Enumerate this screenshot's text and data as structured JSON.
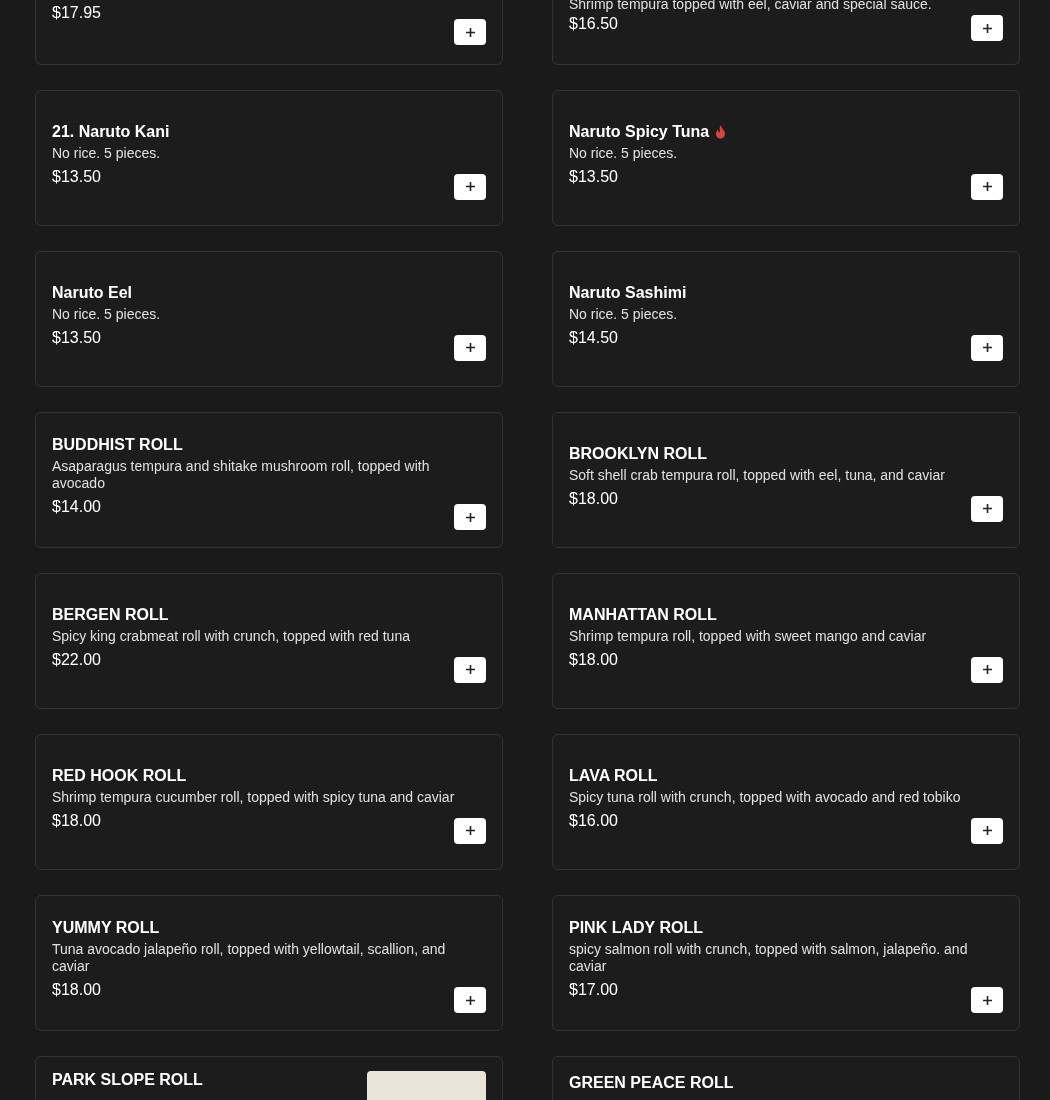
{
  "items": [
    {
      "kind": "top",
      "price": "$17.95"
    },
    {
      "kind": "top",
      "description": "Shrimp tempura topped with eel, caviar and special sauce.",
      "price": "$16.50"
    },
    {
      "kind": "full",
      "name": "21. Naruto Kani",
      "description": "No rice. 5 pieces.",
      "price": "$13.50",
      "spicy": false
    },
    {
      "kind": "full",
      "name": "Naruto Spicy Tuna",
      "description": "No rice. 5 pieces.",
      "price": "$13.50",
      "spicy": true
    },
    {
      "kind": "full",
      "name": "Naruto Eel",
      "description": "No rice. 5 pieces.",
      "price": "$13.50",
      "spicy": false
    },
    {
      "kind": "full",
      "name": "Naruto Sashimi",
      "description": "No rice. 5 pieces.",
      "price": "$14.50",
      "spicy": false
    },
    {
      "kind": "full",
      "name": "BUDDHIST ROLL",
      "description": "Asaparagus tempura and shitake mushroom roll, topped with avocado",
      "price": "$14.00",
      "spicy": false
    },
    {
      "kind": "full",
      "name": "BROOKLYN ROLL",
      "description": "Soft shell crab tempura roll, topped with eel, tuna, and caviar",
      "price": "$18.00",
      "spicy": false
    },
    {
      "kind": "full",
      "name": "BERGEN ROLL",
      "description": "Spicy king crabmeat roll with crunch, topped with red tuna",
      "price": "$22.00",
      "spicy": false
    },
    {
      "kind": "full",
      "name": "MANHATTAN ROLL",
      "description": "Shrimp tempura roll, topped with sweet mango and caviar",
      "price": "$18.00",
      "spicy": false
    },
    {
      "kind": "full",
      "name": "RED HOOK ROLL",
      "description": "Shrimp tempura cucumber roll, topped with spicy tuna and caviar",
      "price": "$18.00",
      "spicy": false
    },
    {
      "kind": "full",
      "name": "LAVA ROLL",
      "description": "Spicy tuna roll with crunch, topped with avocado and red tobiko",
      "price": "$16.00",
      "spicy": false
    },
    {
      "kind": "full",
      "name": "YUMMY ROLL",
      "description": "Tuna avocado jalapeño roll, topped with yellowtail, scallion, and caviar",
      "price": "$18.00",
      "spicy": false
    },
    {
      "kind": "full",
      "name": "PINK LADY ROLL",
      "description": "spicy salmon roll with crunch, topped with salmon, jalapeño. and caviar",
      "price": "$17.00",
      "spicy": false
    },
    {
      "kind": "bottom",
      "name": "PARK SLOPE ROLL",
      "photo": true
    },
    {
      "kind": "bottom",
      "name": "GREEN PEACE ROLL",
      "photo": false
    }
  ]
}
